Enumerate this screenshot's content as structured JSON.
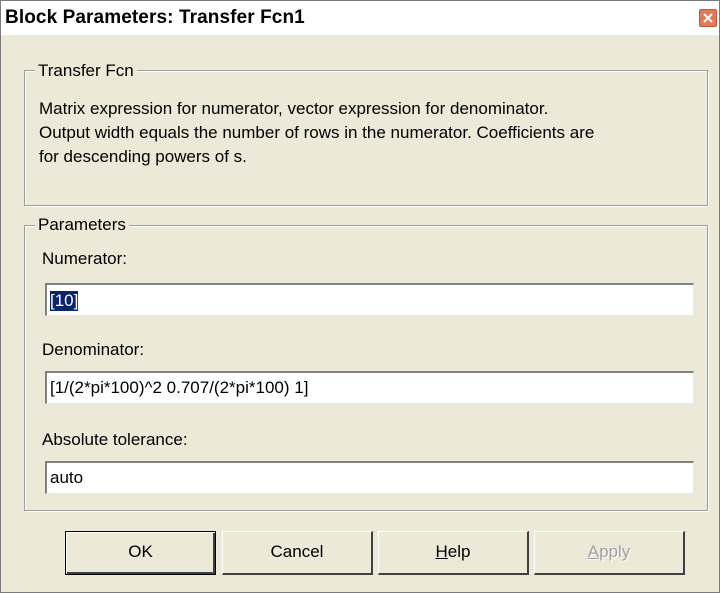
{
  "window": {
    "title": "Block Parameters: Transfer Fcn1",
    "close_icon": "close-icon"
  },
  "description": {
    "group_label": "Transfer Fcn",
    "lines": [
      "Matrix expression for numerator, vector expression for denominator.",
      "Output width equals the number of rows in the numerator.  Coefficients are",
      "for descending powers of s."
    ]
  },
  "parameters": {
    "group_label": "Parameters",
    "numerator": {
      "label": "Numerator:",
      "value": "[10]"
    },
    "denominator": {
      "label": "Denominator:",
      "value": "[1/(2*pi*100)^2 0.707/(2*pi*100) 1]"
    },
    "absolute_tolerance": {
      "label": "Absolute tolerance:",
      "value": "auto"
    }
  },
  "buttons": {
    "ok": "OK",
    "cancel": "Cancel",
    "help": "Help",
    "apply": "Apply"
  },
  "colors": {
    "dialog_background": "#ece9d8",
    "selection_highlight": "#0a246a",
    "close_button": "#e07a5a"
  }
}
